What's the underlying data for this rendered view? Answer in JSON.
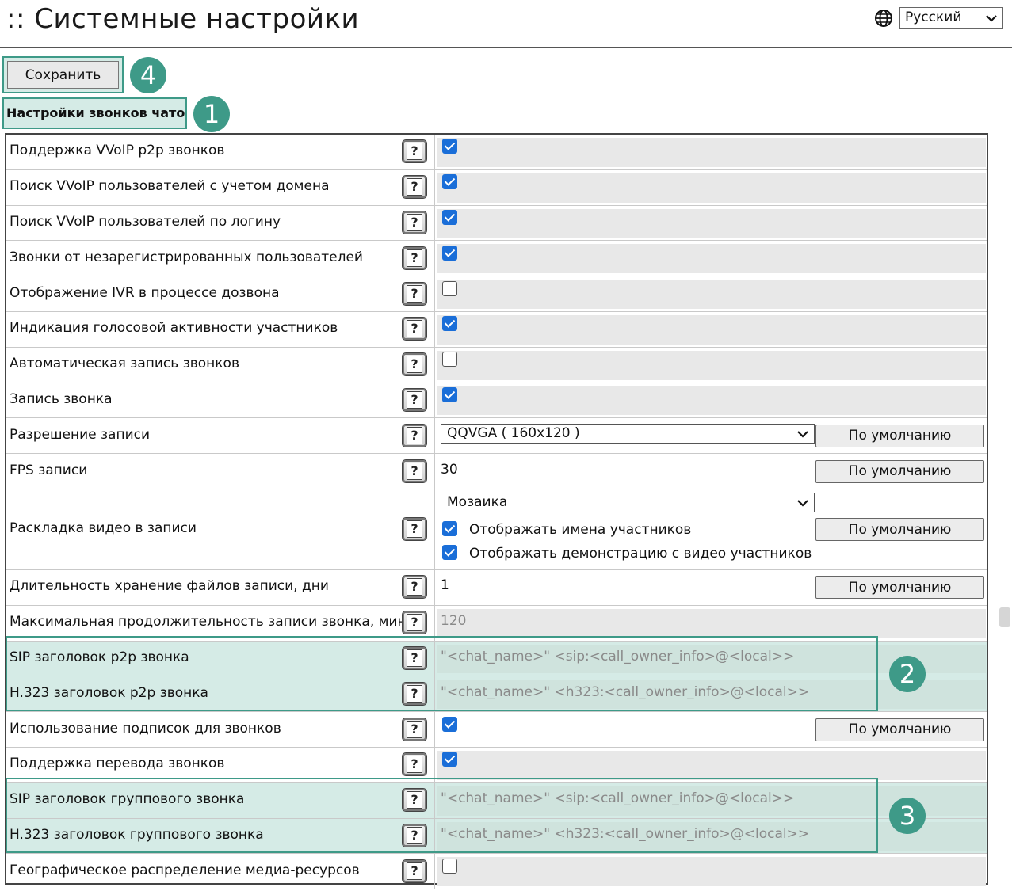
{
  "page": {
    "title": ":: Системные настройки",
    "language": {
      "selected": "Русский",
      "icon": "globe-icon"
    }
  },
  "toolbar": {
    "save_label": "Сохранить"
  },
  "section": {
    "title": "Настройки звонков чатов"
  },
  "callouts": [
    "1",
    "2",
    "3",
    "4"
  ],
  "rows": [
    {
      "label": "Поддержка VVoIP p2p звонков",
      "control": "checkbox",
      "checked": true
    },
    {
      "label": "Поиск VVoIP пользователей с учетом домена",
      "control": "checkbox",
      "checked": true
    },
    {
      "label": "Поиск VVoIP пользователей по логину",
      "control": "checkbox",
      "checked": true
    },
    {
      "label": "Звонки от незарегистрированных пользователей",
      "control": "checkbox",
      "checked": true
    },
    {
      "label": "Отображение IVR в процессе дозвона",
      "control": "checkbox",
      "checked": false
    },
    {
      "label": "Индикация голосовой активности участников",
      "control": "checkbox",
      "checked": true
    },
    {
      "label": "Автоматическая запись звонков",
      "control": "checkbox",
      "checked": false
    },
    {
      "label": "Запись звонка",
      "control": "checkbox",
      "checked": true
    },
    {
      "label": "Разрешение записи",
      "control": "select",
      "value": "QQVGA ( 160x120 )",
      "default_label": "По умолчанию"
    },
    {
      "label": "FPS записи",
      "control": "text",
      "value": "30",
      "default_label": "По умолчанию"
    },
    {
      "label": "Раскладка видео в записи",
      "control": "layout",
      "value": "Мозаика",
      "options": [
        {
          "label": "Отображать имена участников",
          "checked": true
        },
        {
          "label": "Отображать демонстрацию с видео участников",
          "checked": true
        }
      ],
      "default_label": "По умолчанию"
    },
    {
      "label": "Длительность хранение файлов записи, дни",
      "control": "text",
      "value": "1",
      "default_label": "По умолчанию"
    },
    {
      "label": "Максимальная продолжительность записи звонка, мин",
      "control": "readonly",
      "value": "120"
    },
    {
      "label": "SIP заголовок p2p звонка",
      "control": "input",
      "placeholder": "\"<chat_name>\" <sip:<call_owner_info>@<local>>"
    },
    {
      "label": "H.323 заголовок p2p звонка",
      "control": "input",
      "placeholder": "\"<chat_name>\" <h323:<call_owner_info>@<local>>"
    },
    {
      "label": "Использование подписок для звонков",
      "control": "checkbox",
      "checked": true,
      "default_label": "По умолчанию"
    },
    {
      "label": "Поддержка перевода звонков",
      "control": "checkbox",
      "checked": true
    },
    {
      "label": "SIP заголовок группового звонка",
      "control": "input",
      "placeholder": "\"<chat_name>\" <sip:<call_owner_info>@<local>>"
    },
    {
      "label": "H.323 заголовок группового звонка",
      "control": "input",
      "placeholder": "\"<chat_name>\" <h323:<call_owner_info>@<local>>"
    },
    {
      "label": "Географическое распределение медиа-ресурсов",
      "control": "checkbox",
      "checked": false
    }
  ],
  "colors": {
    "accent": "#3e9a88",
    "highlight": "#d5ebe6",
    "checkbox": "#1a6ed8"
  }
}
